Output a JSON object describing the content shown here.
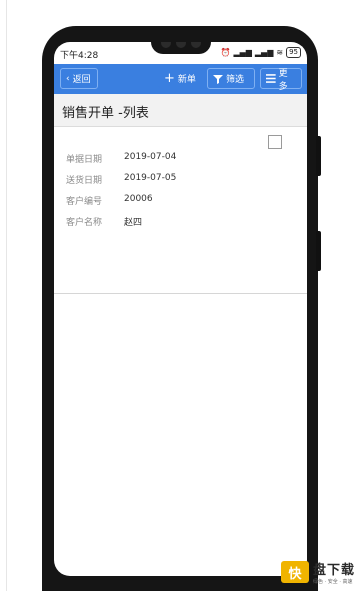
{
  "status_bar": {
    "time": "下午4:28",
    "battery": "95"
  },
  "toolbar": {
    "back_label": "返回",
    "new_label": "新单",
    "filter_label": "筛选",
    "more_label": "更多"
  },
  "page": {
    "title": "销售开单 -列表"
  },
  "record": {
    "fields": [
      {
        "label": "单据日期",
        "value": "2019-07-04"
      },
      {
        "label": "送货日期",
        "value": "2019-07-05"
      },
      {
        "label": "客户编号",
        "value": "20006"
      },
      {
        "label": "客户名称",
        "value": "赵四"
      }
    ]
  },
  "watermark": {
    "logo": "快",
    "name": "盘下载",
    "tagline": "绿色 · 安全 · 高速"
  },
  "colors": {
    "toolbar_bg": "#3a7fe0",
    "watermark_accent": "#f0b400"
  },
  "icons": {
    "back": "chevron-left-icon",
    "new": "plus-icon",
    "filter": "funnel-icon",
    "more": "menu-icon"
  }
}
